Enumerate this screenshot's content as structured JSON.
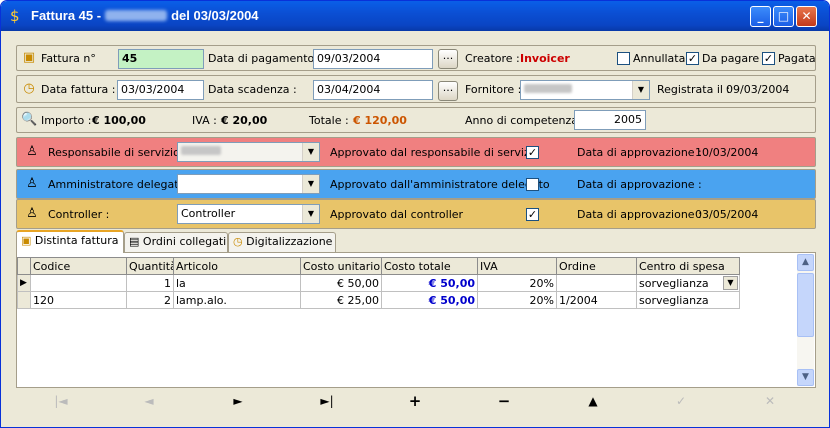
{
  "window": {
    "title_prefix": "Fattura 45 -",
    "title_suffix": "del 03/03/2004",
    "minimize": "_",
    "maximize": "□",
    "close": "✕"
  },
  "row1": {
    "fattura_label": "Fattura n°",
    "fattura_value": "45",
    "pagamento_label": "Data di pagamento :",
    "pagamento_value": "09/03/2004",
    "dots": "...",
    "creatore_label": "Creatore :",
    "creatore_value": "Invoicer",
    "annullata_label": "Annullata",
    "annullata_checked": "",
    "dapagare_label": "Da pagare",
    "dapagare_checked": "✓",
    "pagata_label": "Pagata",
    "pagata_checked": "✓"
  },
  "row2": {
    "data_fattura_label": "Data fattura :",
    "data_fattura_value": "03/03/2004",
    "scadenza_label": "Data scadenza :",
    "scadenza_value": "03/04/2004",
    "dots": "...",
    "fornitore_label": "Fornitore :",
    "registrata_label": "Registrata il :",
    "registrata_value": "09/03/2004"
  },
  "row3": {
    "importo_label": "Importo :",
    "importo_value": "€ 100,00",
    "iva_label": "IVA :",
    "iva_value": "€ 20,00",
    "totale_label": "Totale :",
    "totale_value": "€ 120,00",
    "anno_label": "Anno di competenza :",
    "anno_value": "2005"
  },
  "approvals": [
    {
      "label": "Responsabile di servizio :",
      "combo": "",
      "approved_label": "Approvato dal responsabile di servizio",
      "checked": "✓",
      "date_label": "Data di approvazione :",
      "date": "10/03/2004",
      "color": "#f08080"
    },
    {
      "label": "Amministratore delegato :",
      "combo": "",
      "approved_label": "Approvato dall'amministratore delegato",
      "checked": "",
      "date_label": "Data di approvazione :",
      "date": "",
      "color": "#4aa3f0"
    },
    {
      "label": "Controller :",
      "combo": "Controller",
      "approved_label": "Approvato dal controller",
      "checked": "✓",
      "date_label": "Data di approvazione :",
      "date": "03/05/2004",
      "color": "#e8c469"
    }
  ],
  "tabs": [
    "Distinta fattura",
    "Ordini collegati",
    "Digitalizzazione"
  ],
  "table": {
    "headers": [
      "Codice",
      "Quantità",
      "Articolo",
      "Costo unitario",
      "Costo totale",
      "IVA",
      "Ordine",
      "Centro di spesa"
    ],
    "rows": [
      [
        "",
        "1",
        "la",
        "€ 50,00",
        "€ 50,00",
        "20%",
        "",
        "sorveglianza"
      ],
      [
        "120",
        "2",
        "lamp.alo.",
        "€ 25,00",
        "€ 50,00",
        "20%",
        "1/2004",
        "sorveglianza"
      ]
    ]
  },
  "navigator": [
    "|◄",
    "◄",
    "►",
    "►|",
    "+",
    "−",
    "▲",
    "✓",
    "✕"
  ],
  "colors": {
    "green_field": "#c4f2c4",
    "totale": "#cc5500",
    "creatore": "#cc0000"
  }
}
